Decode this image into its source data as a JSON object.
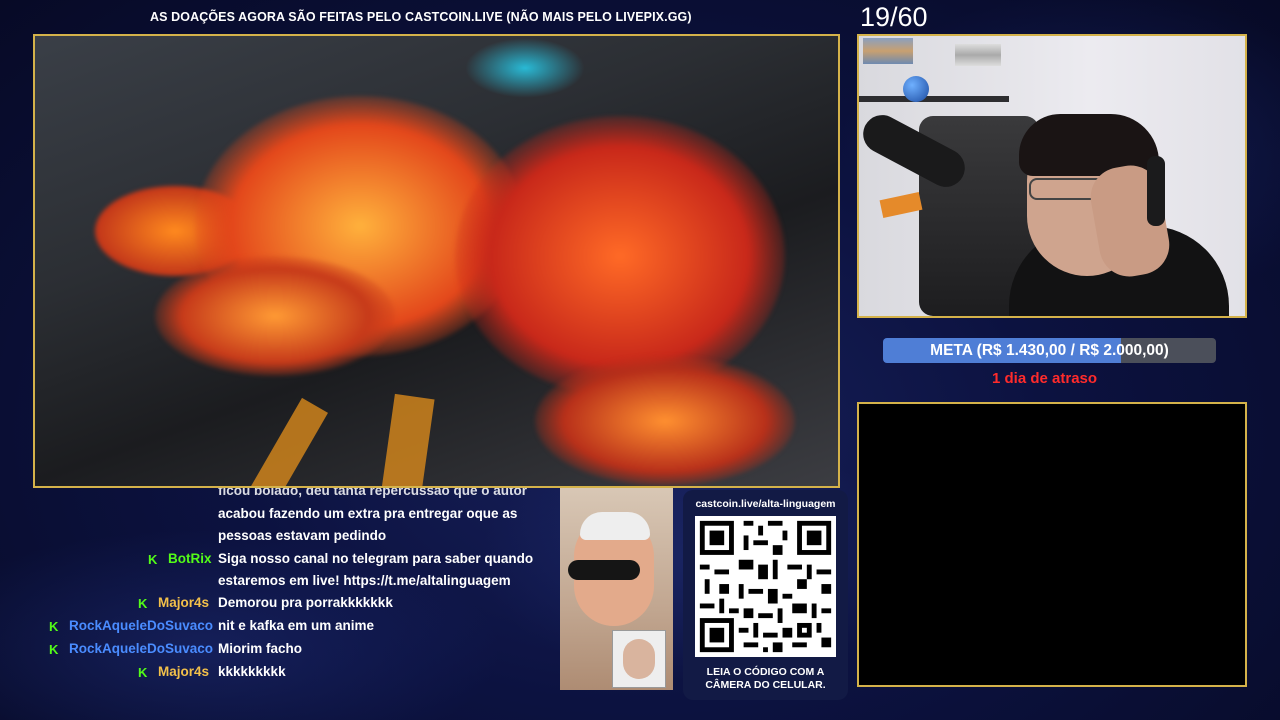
{
  "banner": "AS DOAÇÕES AGORA SÃO FEITAS PELO CASTCOIN.LIVE (NÃO MAIS PELO LIVEPIX.GG)",
  "counter": "19/60",
  "goal": {
    "label": "META (R$ 1.430,00 / R$ 2.000,00)",
    "progress": 0.715,
    "fill_color": "#4f7ed6"
  },
  "delay_text": "1 dia de atraso",
  "chat": {
    "partial_lines": [
      "ficou bolado, deu tanta repercussão que o autor",
      "acabou fazendo um extra pra entregar oque as",
      "pessoas estavam pedindo"
    ],
    "messages": [
      {
        "user": "BotRix",
        "user_color": "#53fc18",
        "text": "Siga nosso canal no telegram para saber quando",
        "text2": "estaremos em live! https://t.me/altalinguagem"
      },
      {
        "user": "Major4s",
        "user_color": "#f2c04a",
        "text": "Demorou pra porrakkkkkkk"
      },
      {
        "user": "RockAqueleDoSuvaco",
        "user_color": "#4a8cff",
        "text": "nit e kafka em um anime"
      },
      {
        "user": "RockAqueleDoSuvaco",
        "user_color": "#4a8cff",
        "text": "Miorim facho"
      },
      {
        "user": "Major4s",
        "user_color": "#f2c04a",
        "text": "kkkkkkkkk"
      }
    ]
  },
  "qr": {
    "url": "castcoin.live/alta-linguagem",
    "caption_line1": "LEIA O CÓDIGO COM A",
    "caption_line2": "CÂMERA DO CELULAR."
  },
  "colors": {
    "frame_border": "#d4b24a",
    "delay_red": "#ff2b2b",
    "kick_badge": "#53fc18"
  }
}
